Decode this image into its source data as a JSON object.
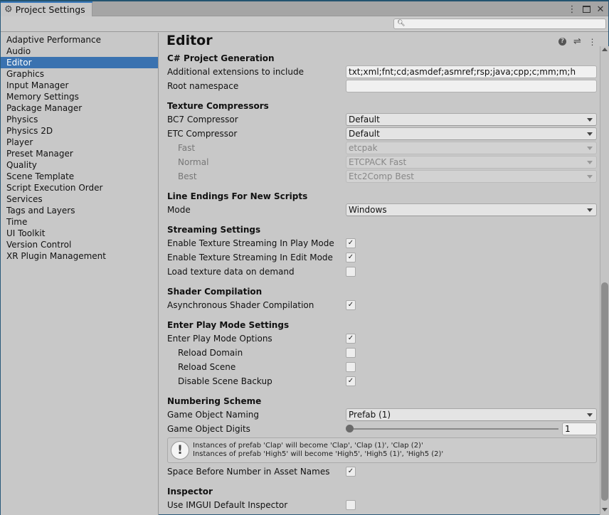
{
  "window": {
    "tab_title": "Project Settings",
    "controls": [
      "more-options",
      "maximize",
      "close"
    ]
  },
  "search": {
    "placeholder": "",
    "value": ""
  },
  "sidebar": {
    "items": [
      {
        "label": "Adaptive Performance",
        "active": false
      },
      {
        "label": "Audio",
        "active": false
      },
      {
        "label": "Editor",
        "active": true
      },
      {
        "label": "Graphics",
        "active": false
      },
      {
        "label": "Input Manager",
        "active": false
      },
      {
        "label": "Memory Settings",
        "active": false
      },
      {
        "label": "Package Manager",
        "active": false
      },
      {
        "label": "Physics",
        "active": false
      },
      {
        "label": "Physics 2D",
        "active": false
      },
      {
        "label": "Player",
        "active": false
      },
      {
        "label": "Preset Manager",
        "active": false
      },
      {
        "label": "Quality",
        "active": false
      },
      {
        "label": "Scene Template",
        "active": false
      },
      {
        "label": "Script Execution Order",
        "active": false
      },
      {
        "label": "Services",
        "active": false
      },
      {
        "label": "Tags and Layers",
        "active": false
      },
      {
        "label": "Time",
        "active": false
      },
      {
        "label": "UI Toolkit",
        "active": false
      },
      {
        "label": "Version Control",
        "active": false
      },
      {
        "label": "XR Plugin Management",
        "active": false
      }
    ]
  },
  "main": {
    "title": "Editor",
    "header_icons": [
      "help-icon",
      "presets-icon",
      "more-icon"
    ],
    "csharp": {
      "heading": "C# Project Generation",
      "extensions_label": "Additional extensions to include",
      "extensions_value": "txt;xml;fnt;cd;asmdef;asmref;rsp;java;cpp;c;mm;m;h",
      "namespace_label": "Root namespace",
      "namespace_value": ""
    },
    "texture": {
      "heading": "Texture Compressors",
      "bc7_label": "BC7 Compressor",
      "bc7_value": "Default",
      "etc_label": "ETC Compressor",
      "etc_value": "Default",
      "fast_label": "Fast",
      "fast_value": "etcpak",
      "normal_label": "Normal",
      "normal_value": "ETCPACK Fast",
      "best_label": "Best",
      "best_value": "Etc2Comp Best"
    },
    "line_endings": {
      "heading": "Line Endings For New Scripts",
      "mode_label": "Mode",
      "mode_value": "Windows"
    },
    "streaming": {
      "heading": "Streaming Settings",
      "play_label": "Enable Texture Streaming In Play Mode",
      "play_checked": true,
      "edit_label": "Enable Texture Streaming In Edit Mode",
      "edit_checked": true,
      "demand_label": "Load texture data on demand",
      "demand_checked": false
    },
    "shader": {
      "heading": "Shader Compilation",
      "async_label": "Asynchronous Shader Compilation",
      "async_checked": true
    },
    "play_mode": {
      "heading": "Enter Play Mode Settings",
      "options_label": "Enter Play Mode Options",
      "options_checked": true,
      "domain_label": "Reload Domain",
      "domain_checked": false,
      "scene_label": "Reload Scene",
      "scene_checked": false,
      "backup_label": "Disable Scene Backup",
      "backup_checked": true
    },
    "numbering": {
      "heading": "Numbering Scheme",
      "naming_label": "Game Object Naming",
      "naming_value": "Prefab (1)",
      "digits_label": "Game Object Digits",
      "digits_value": "1",
      "help_line1": "Instances of prefab 'Clap' will become 'Clap', 'Clap (1)', 'Clap (2)'",
      "help_line2": "Instances of prefab 'High5' will become 'High5', 'High5 (1)', 'High5 (2)'",
      "space_label": "Space Before Number in Asset Names",
      "space_checked": true
    },
    "inspector": {
      "heading": "Inspector",
      "imgui_label": "Use IMGUI Default Inspector",
      "imgui_checked": false
    }
  },
  "check_glyph": "✓"
}
